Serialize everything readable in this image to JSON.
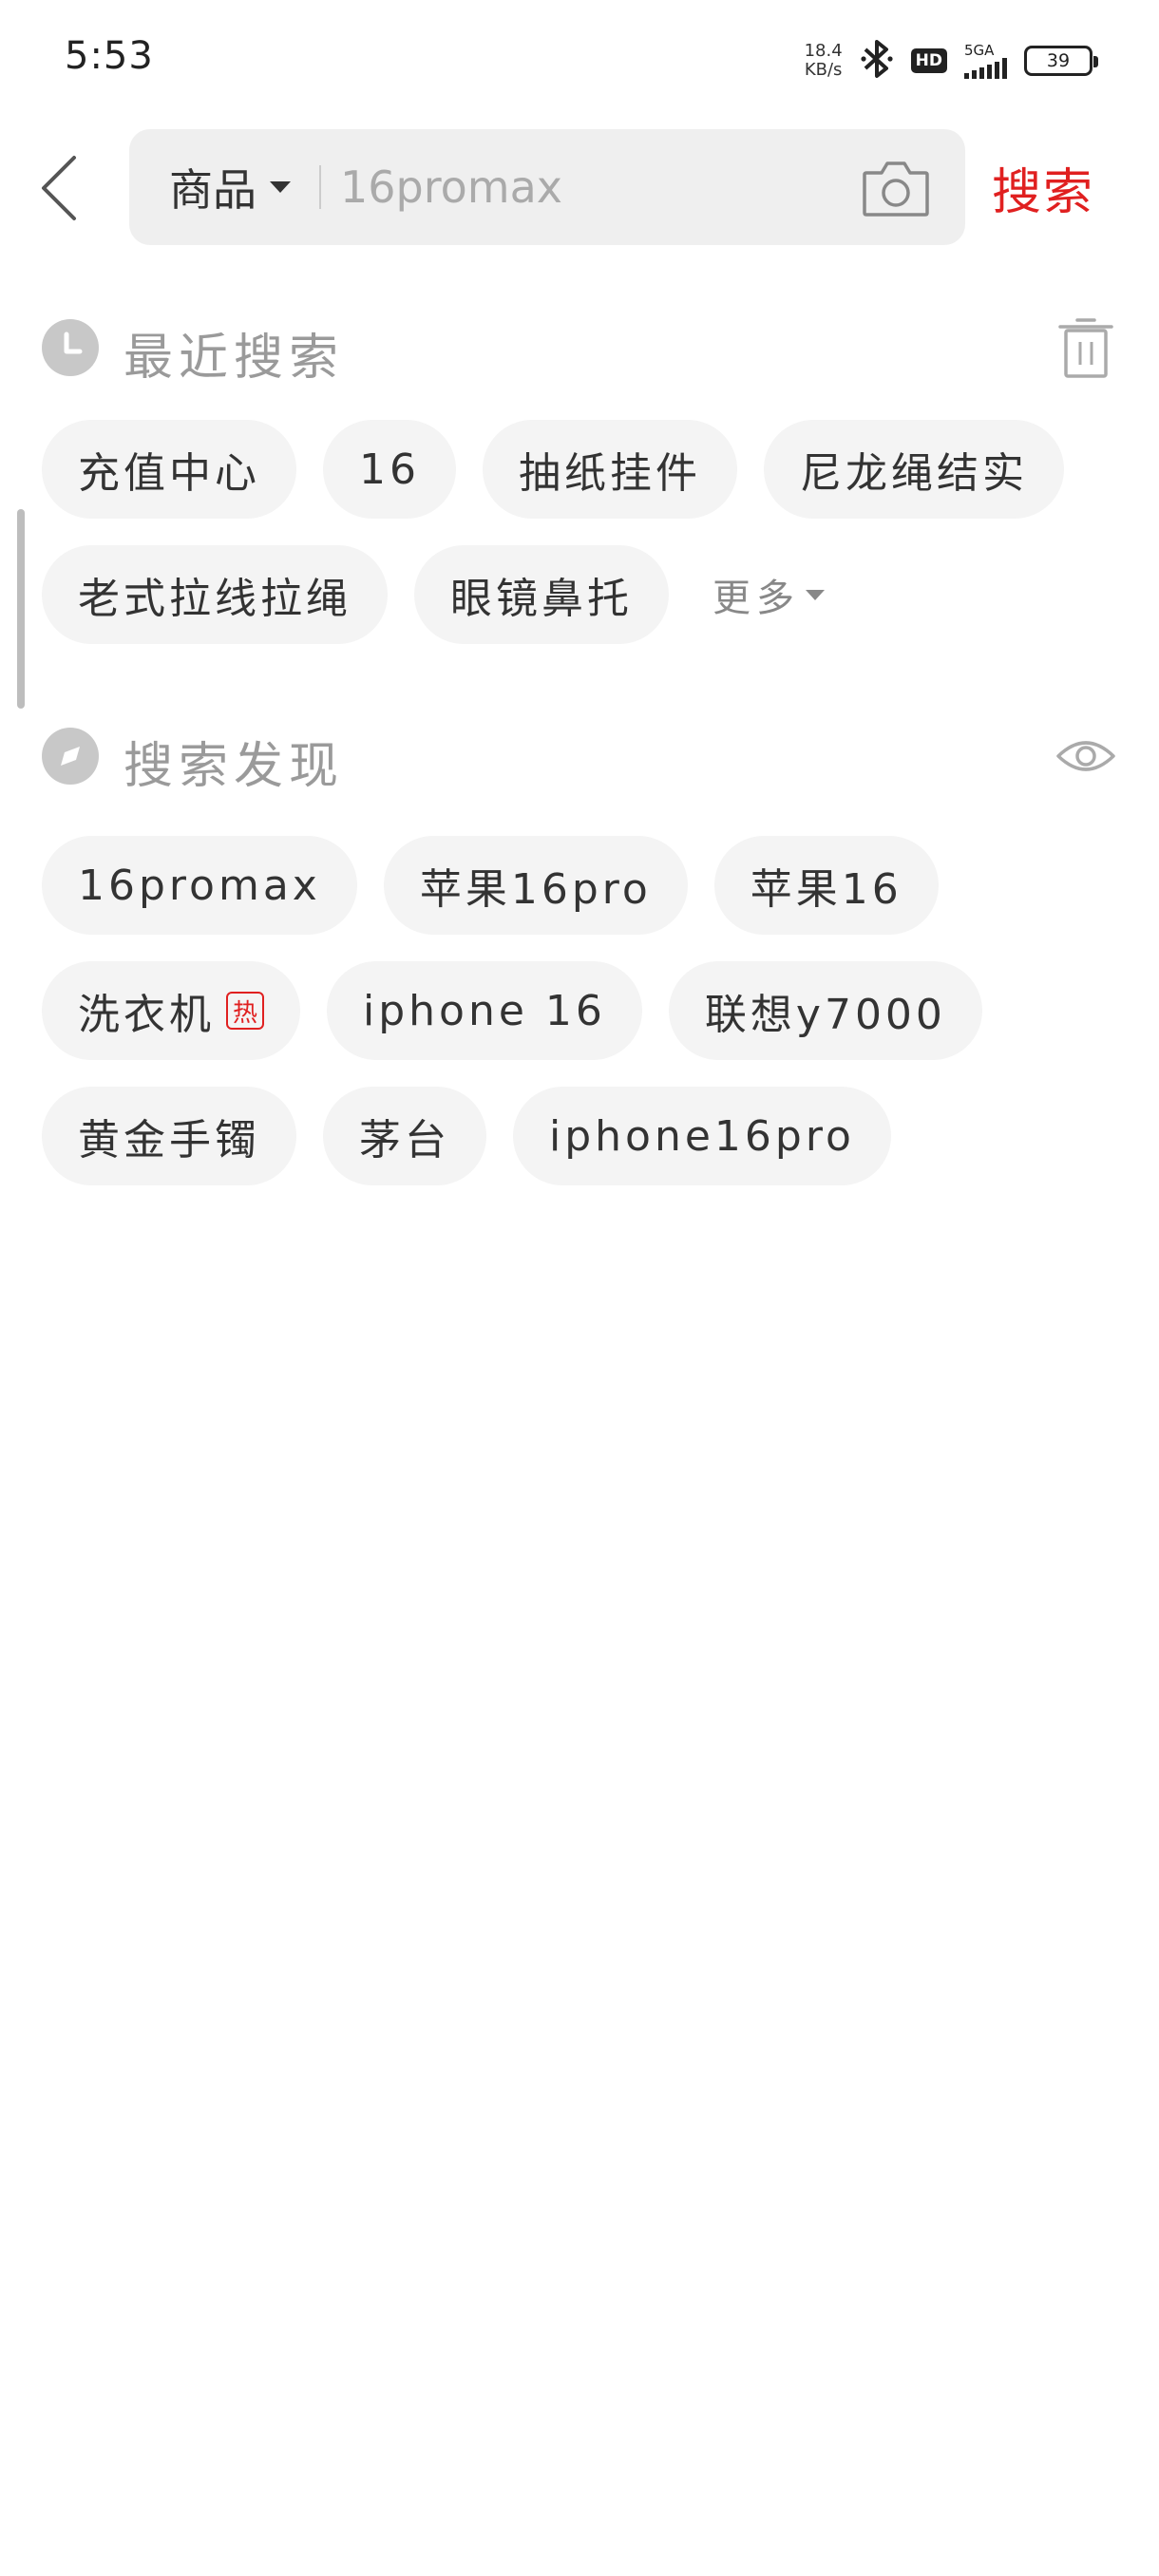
{
  "status_bar": {
    "time": "5:53",
    "net_speed_value": "18.4",
    "net_speed_unit": "KB/s",
    "hd": "HD",
    "network": "5GA",
    "battery": "39"
  },
  "header": {
    "scope_label": "商品",
    "search_value": "16promax",
    "search_button": "搜索"
  },
  "recent": {
    "title": "最近搜索",
    "items": [
      "充值中心",
      "16",
      "抽纸挂件",
      "尼龙绳结实",
      "老式拉线拉绳",
      "眼镜鼻托"
    ],
    "more_label": "更多"
  },
  "discover": {
    "title": "搜索发现",
    "items": [
      {
        "label": "16promax"
      },
      {
        "label": "苹果16pro"
      },
      {
        "label": "苹果16"
      },
      {
        "label": "洗衣机",
        "badge": "热"
      },
      {
        "label": "iphone 16"
      },
      {
        "label": "联想y7000"
      },
      {
        "label": "黄金手镯"
      },
      {
        "label": "茅台"
      },
      {
        "label": "iphone16pro"
      }
    ]
  },
  "colors": {
    "accent": "#e02020",
    "chip_bg": "#f4f4f4",
    "search_bg": "#efefef",
    "section_title": "#9a9a9a"
  },
  "icons": {
    "back": "chevron-left-icon",
    "camera": "camera-icon",
    "clock": "clock-icon",
    "trash": "trash-icon",
    "compass": "compass-icon",
    "eye": "eye-icon"
  }
}
